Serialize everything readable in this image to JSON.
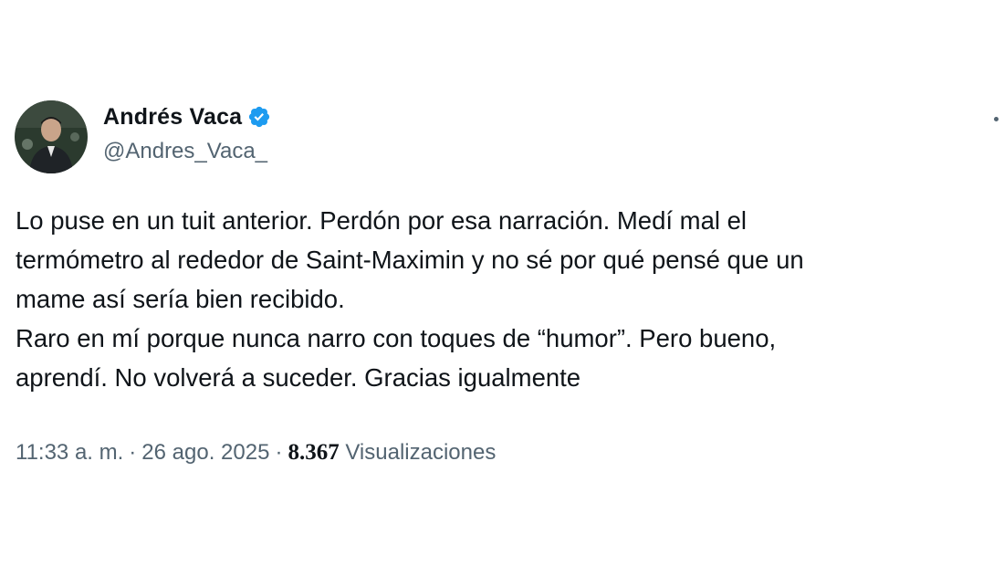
{
  "author": {
    "name": "Andrés Vaca",
    "handle": "@Andres_Vaca_",
    "verified_color": "#1d9bf0",
    "avatar_icon": "profile-photo"
  },
  "tweet": {
    "lines": [
      "Lo puse en un tuit anterior. Perdón por esa narración. Medí mal el",
      "termómetro al rededor de Saint-Maximin y no sé por qué pensé que un",
      "mame así sería bien recibido.",
      "Raro en mí porque nunca narro con toques de “humor”. Pero bueno,",
      "aprendí. No volverá a suceder. Gracias igualmente"
    ]
  },
  "meta": {
    "time": "11:33 a. m.",
    "separator": "·",
    "date": "26 ago. 2025",
    "views_count": "8.367",
    "views_label": "Visualizaciones"
  },
  "icons": {
    "more": "more-options-icon",
    "verified": "verified-badge-icon"
  },
  "colors": {
    "text": "#0f1419",
    "secondary": "#536471",
    "accent": "#1d9bf0"
  }
}
